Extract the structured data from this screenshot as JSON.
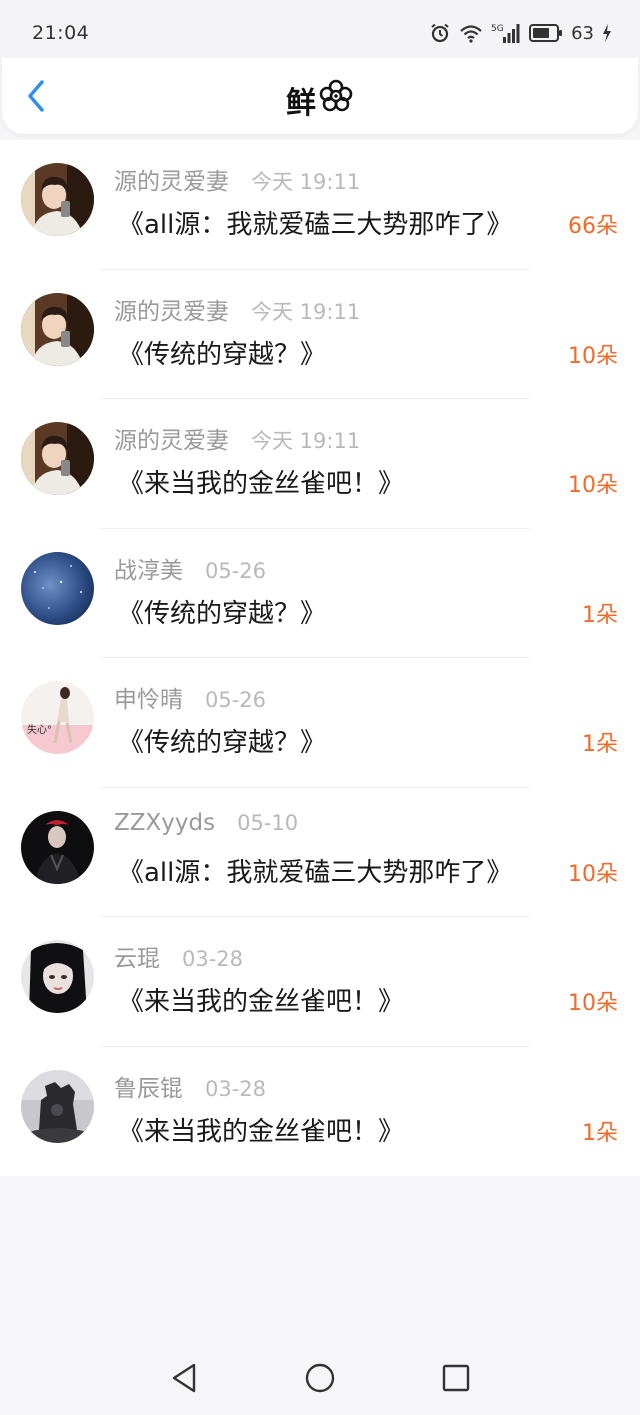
{
  "status": {
    "time": "21:04",
    "network": "5G",
    "battery": "63"
  },
  "header": {
    "title": "鲜"
  },
  "colors": {
    "accent": "#f06a2a",
    "back": "#2b8ef0"
  },
  "rows": [
    {
      "name": "源的灵爱妻",
      "time": "今天 19:11",
      "book": "《all源：我就爱磕三大势那咋了》",
      "count": "66朵",
      "avatar": "avatar-1"
    },
    {
      "name": "源的灵爱妻",
      "time": "今天 19:11",
      "book": "《传统的穿越？》",
      "count": "10朵",
      "avatar": "avatar-1"
    },
    {
      "name": "源的灵爱妻",
      "time": "今天 19:11",
      "book": "《来当我的金丝雀吧！》",
      "count": "10朵",
      "avatar": "avatar-1"
    },
    {
      "name": "战淳美",
      "time": "05-26",
      "book": "《传统的穿越？》",
      "count": "1朵",
      "avatar": "avatar-2"
    },
    {
      "name": "申怜晴",
      "time": "05-26",
      "book": "《传统的穿越？》",
      "count": "1朵",
      "avatar": "avatar-3"
    },
    {
      "name": "ZZXyyds",
      "time": "05-10",
      "book": "《all源：我就爱磕三大势那咋了》",
      "count": "10朵",
      "avatar": "avatar-4"
    },
    {
      "name": "云琨",
      "time": "03-28",
      "book": "《来当我的金丝雀吧！》",
      "count": "10朵",
      "avatar": "avatar-5"
    },
    {
      "name": "鲁辰锟",
      "time": "03-28",
      "book": "《来当我的金丝雀吧！》",
      "count": "1朵",
      "avatar": "avatar-6"
    }
  ],
  "avatar3_text": "失心°",
  "icons": [
    "alarm-icon",
    "wifi-icon",
    "signal-icon",
    "battery-icon",
    "back-arrow-icon",
    "flower-icon",
    "nav-back-icon",
    "nav-home-icon",
    "nav-recents-icon"
  ]
}
